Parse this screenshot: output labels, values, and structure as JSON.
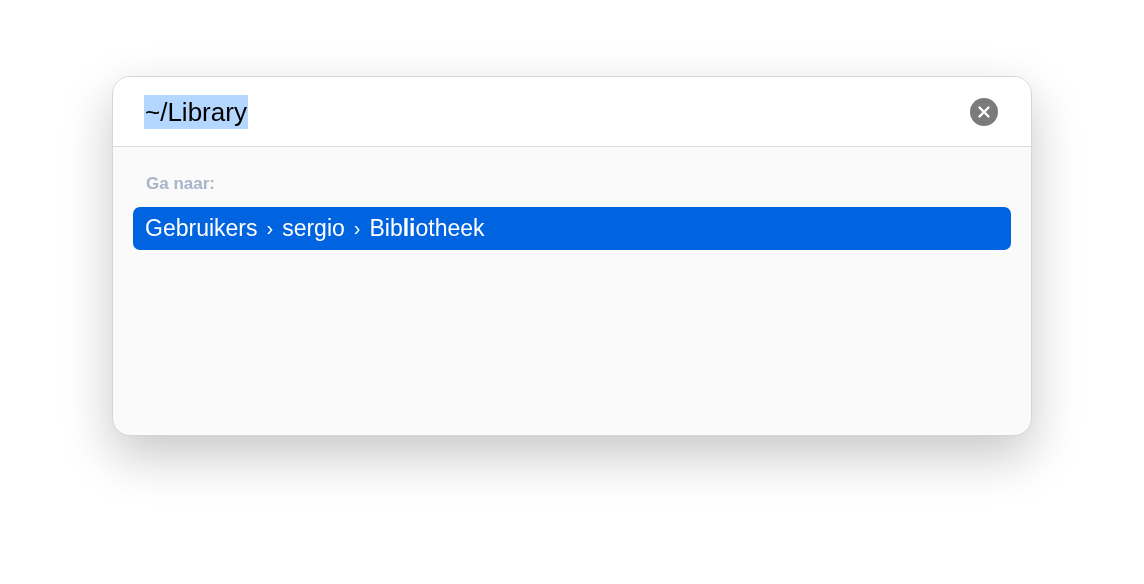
{
  "search": {
    "value": "~/Library",
    "text_selected": true
  },
  "section_label": "Ga naar:",
  "results": [
    {
      "selected": true,
      "parts": [
        {
          "kind": "segment",
          "text": "Gebruikers"
        },
        {
          "kind": "separator",
          "text": "›"
        },
        {
          "kind": "segment",
          "text": "sergio"
        },
        {
          "kind": "separator",
          "text": "›"
        },
        {
          "kind": "segment",
          "text": "Bib**li**otheek"
        }
      ]
    }
  ]
}
